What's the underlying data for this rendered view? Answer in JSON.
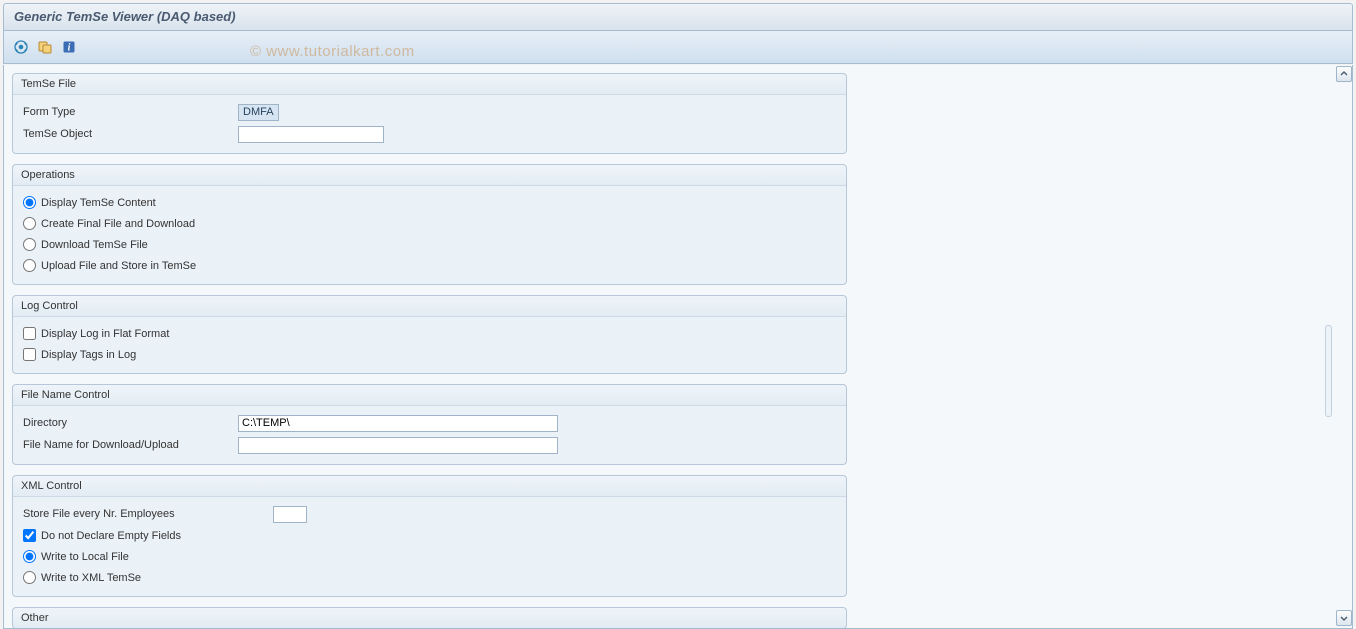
{
  "title": "Generic TemSe Viewer (DAQ based)",
  "watermark": "© www.tutorialkart.com",
  "toolbar": {
    "execute_icon": "execute-icon",
    "variant_icon": "variant-icon",
    "info_icon": "info-icon"
  },
  "groups": {
    "temse_file": {
      "title": "TemSe File",
      "form_type_label": "Form Type",
      "form_type_value": "DMFA",
      "temse_object_label": "TemSe Object",
      "temse_object_value": ""
    },
    "operations": {
      "title": "Operations",
      "options": [
        {
          "label": "Display TemSe Content",
          "checked": true
        },
        {
          "label": "Create Final File and Download",
          "checked": false
        },
        {
          "label": "Download TemSe File",
          "checked": false
        },
        {
          "label": "Upload File and Store in TemSe",
          "checked": false
        }
      ]
    },
    "log_control": {
      "title": "Log Control",
      "options": [
        {
          "label": "Display Log in Flat Format",
          "checked": false
        },
        {
          "label": "Display Tags in Log",
          "checked": false
        }
      ]
    },
    "file_name_control": {
      "title": "File Name Control",
      "directory_label": "Directory",
      "directory_value": "C:\\TEMP\\",
      "file_name_label": "File Name for Download/Upload",
      "file_name_value": ""
    },
    "xml_control": {
      "title": "XML Control",
      "store_label": "Store File every Nr. Employees",
      "store_value": "",
      "declare_label": "Do not Declare Empty Fields",
      "declare_checked": true,
      "radios": [
        {
          "label": "Write to Local File",
          "checked": true
        },
        {
          "label": "Write to XML TemSe",
          "checked": false
        }
      ]
    },
    "other": {
      "title": "Other"
    }
  }
}
